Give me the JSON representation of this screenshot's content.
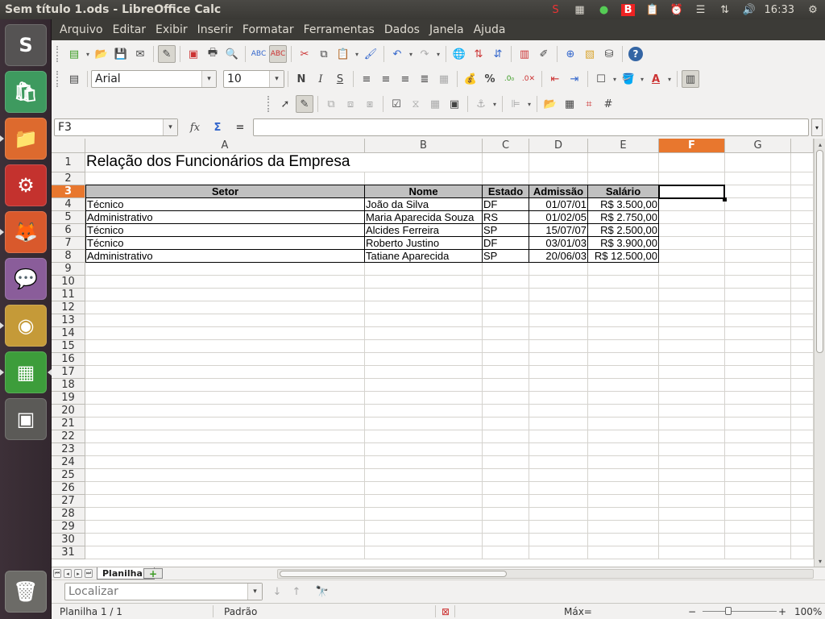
{
  "window": {
    "title": "Sem título 1.ods - LibreOffice Calc"
  },
  "panel": {
    "clock": "16:33"
  },
  "launcher": {
    "items": [
      {
        "name": "ubuntu-dash",
        "glyph": "S",
        "color": "#555353"
      },
      {
        "name": "software-center",
        "glyph": "🛍",
        "color": "#3e9a5f"
      },
      {
        "name": "files",
        "glyph": "📁",
        "color": "#dd6a2e"
      },
      {
        "name": "system-settings",
        "glyph": "⚙",
        "color": "#c4322e"
      },
      {
        "name": "firefox",
        "glyph": "🦊",
        "color": "#d9592c"
      },
      {
        "name": "pidgin",
        "glyph": "💬",
        "color": "#8a5d9a"
      },
      {
        "name": "chrome",
        "glyph": "◉",
        "color": "#c59a38"
      },
      {
        "name": "libreoffice-calc",
        "glyph": "▦",
        "color": "#3d9d3b"
      },
      {
        "name": "workspaces",
        "glyph": "▣",
        "color": "#5b5a57"
      },
      {
        "name": "trash",
        "glyph": "🗑",
        "color": "#6c6b67"
      }
    ]
  },
  "menu": [
    "Arquivo",
    "Editar",
    "Exibir",
    "Inserir",
    "Formatar",
    "Ferramentas",
    "Dados",
    "Janela",
    "Ajuda"
  ],
  "format": {
    "font_name": "Arial",
    "font_size": "10"
  },
  "formula": {
    "namebox": "F3",
    "value": ""
  },
  "columns": [
    {
      "label": "A"
    },
    {
      "label": "B"
    },
    {
      "label": "C"
    },
    {
      "label": "D"
    },
    {
      "label": "E"
    },
    {
      "label": "F"
    },
    {
      "label": "G"
    }
  ],
  "active_cell": {
    "col": "F",
    "row": "3"
  },
  "rows": [
    "1",
    "2",
    "3",
    "4",
    "5",
    "6",
    "7",
    "8",
    "9",
    "10",
    "11",
    "12",
    "13",
    "14",
    "15",
    "16",
    "17",
    "18",
    "19",
    "20",
    "21",
    "22",
    "23",
    "24",
    "25",
    "26",
    "27",
    "28",
    "29",
    "30",
    "31"
  ],
  "sheet": {
    "title": "Relação dos Funcionários da Empresa",
    "headers": [
      "Setor",
      "Nome",
      "Estado",
      "Admissão",
      "Salário"
    ],
    "records": [
      [
        "Técnico",
        "João da Silva",
        "DF",
        "01/07/01",
        "R$ 3.500,00"
      ],
      [
        "Administrativo",
        "Maria Aparecida Souza",
        "RS",
        "01/02/05",
        "R$ 2.750,00"
      ],
      [
        "Técnico",
        "Alcides Ferreira",
        "SP",
        "15/07/07",
        "R$ 2.500,00"
      ],
      [
        "Técnico",
        "Roberto Justino",
        "DF",
        "03/01/03",
        "R$ 3.900,00"
      ],
      [
        "Administrativo",
        "Tatiane Aparecida",
        "SP",
        "20/06/03",
        "R$ 12.500,00"
      ]
    ]
  },
  "tabs": {
    "active": "Planilha1",
    "add": "+"
  },
  "find": {
    "placeholder": "Localizar"
  },
  "status": {
    "sheet": "Planilha 1 / 1",
    "style": "Padrão",
    "sum": "Máx=",
    "zoom": "100%"
  },
  "colors": {
    "accent": "#e8772e",
    "header_fill": "#c0c0c0"
  }
}
